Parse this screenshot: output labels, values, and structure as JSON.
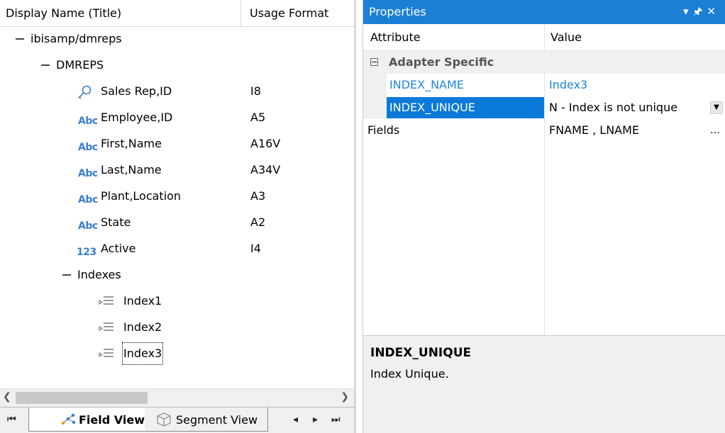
{
  "tree": {
    "headers": {
      "name": "Display Name (Title)",
      "format": "Usage Format"
    },
    "root": "ibisamp/dmreps",
    "segment": "DMREPS",
    "fields": [
      {
        "icon": "key-icon",
        "label": "Sales Rep,ID",
        "format": "I8"
      },
      {
        "icon": "abc-icon",
        "icon_text": "Abc",
        "label": "Employee,ID",
        "format": "A5"
      },
      {
        "icon": "abc-icon",
        "icon_text": "Abc",
        "label": "First,Name",
        "format": "A16V"
      },
      {
        "icon": "abc-icon",
        "icon_text": "Abc",
        "label": "Last,Name",
        "format": "A34V"
      },
      {
        "icon": "abc-icon",
        "icon_text": "Abc",
        "label": "Plant,Location",
        "format": "A3"
      },
      {
        "icon": "abc-icon",
        "icon_text": "Abc",
        "label": "State",
        "format": "A2"
      },
      {
        "icon": "numeric-icon",
        "icon_text": "123",
        "label": "Active",
        "format": "I4"
      }
    ],
    "indexes_label": "Indexes",
    "indexes": [
      "Index1",
      "Index2",
      "Index3"
    ],
    "selected_index": "Index3"
  },
  "tabs": {
    "field_view": "Field View",
    "segment_view": "Segment View"
  },
  "properties": {
    "title": "Properties",
    "col_attribute": "Attribute",
    "col_value": "Value",
    "category": "Adapter Specific",
    "rows": [
      {
        "name": "INDEX_NAME",
        "value": "Index3"
      },
      {
        "name": "INDEX_UNIQUE",
        "value": "N - Index is not unique"
      }
    ],
    "fields_row": {
      "name": "Fields",
      "value": "FNAME , LNAME"
    },
    "description": {
      "title": "INDEX_UNIQUE",
      "body": "Index Unique."
    }
  },
  "colors": {
    "accent": "#1c7fd6",
    "link_blue": "#1e86dd",
    "selection": "#0a79d8"
  }
}
